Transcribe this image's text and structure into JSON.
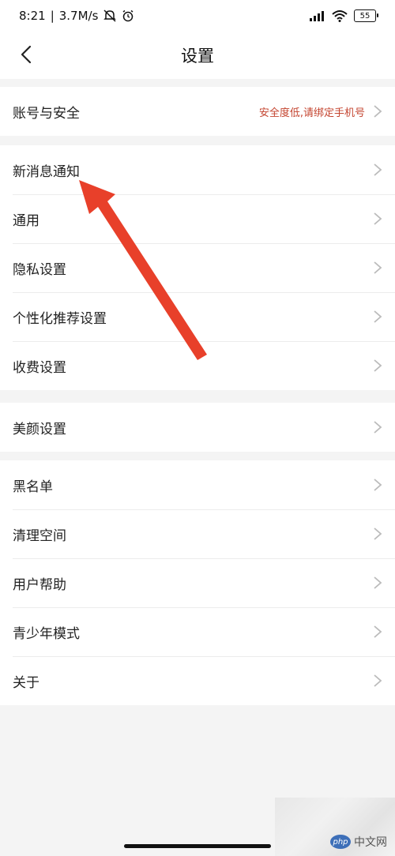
{
  "status_bar": {
    "time": "8:21",
    "speed": "3.7M/s",
    "battery": "55",
    "icons": [
      "mute-icon",
      "alarm-icon",
      "hd-signal-icon",
      "wifi-icon",
      "battery-icon"
    ]
  },
  "header": {
    "title": "设置"
  },
  "groups": [
    {
      "items": [
        {
          "label": "账号与安全",
          "hint": "安全度低,请绑定手机号"
        }
      ]
    },
    {
      "items": [
        {
          "label": "新消息通知"
        },
        {
          "label": "通用"
        },
        {
          "label": "隐私设置"
        },
        {
          "label": "个性化推荐设置"
        },
        {
          "label": "收费设置"
        }
      ]
    },
    {
      "items": [
        {
          "label": "美颜设置"
        }
      ]
    },
    {
      "items": [
        {
          "label": "黑名单"
        },
        {
          "label": "清理空间"
        },
        {
          "label": "用户帮助"
        },
        {
          "label": "青少年模式"
        },
        {
          "label": "关于"
        }
      ]
    }
  ],
  "watermark": {
    "logo_text": "中文网",
    "logo_badge": "php"
  },
  "colors": {
    "hint": "#c4442f",
    "annotation_arrow": "#e8402a"
  }
}
